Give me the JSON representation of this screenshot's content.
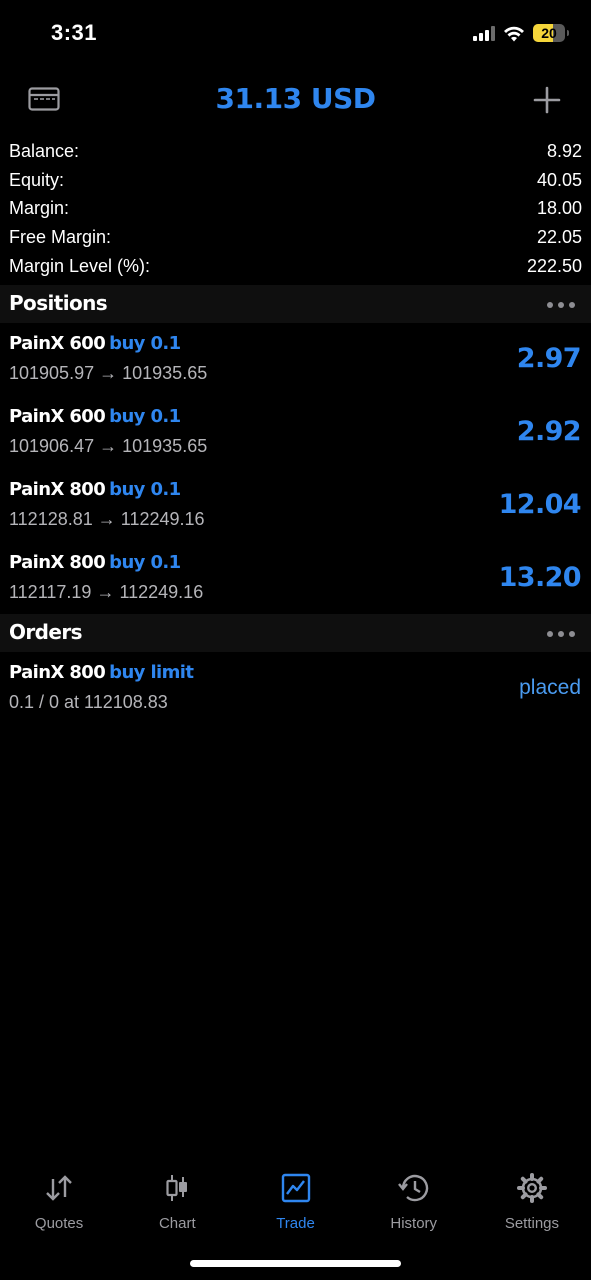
{
  "status_bar": {
    "time": "3:31",
    "battery_level": "20"
  },
  "header": {
    "title": "31.13 USD",
    "left_icon": "wallet-card-icon",
    "right_icon": "plus-icon"
  },
  "summary": [
    {
      "label": "Balance:",
      "value": "8.92"
    },
    {
      "label": "Equity:",
      "value": "40.05"
    },
    {
      "label": "Margin:",
      "value": "18.00"
    },
    {
      "label": "Free Margin:",
      "value": "22.05"
    },
    {
      "label": "Margin Level (%):",
      "value": "222.50"
    }
  ],
  "positions": {
    "title": "Positions",
    "items": [
      {
        "symbol": "PainX 600",
        "type": "buy 0.1",
        "open_price": "101905.97",
        "current_price": "101935.65",
        "profit": "2.97"
      },
      {
        "symbol": "PainX 600",
        "type": "buy 0.1",
        "open_price": "101906.47",
        "current_price": "101935.65",
        "profit": "2.92"
      },
      {
        "symbol": "PainX 800",
        "type": "buy 0.1",
        "open_price": "112128.81",
        "current_price": "112249.16",
        "profit": "12.04"
      },
      {
        "symbol": "PainX 800",
        "type": "buy 0.1",
        "open_price": "112117.19",
        "current_price": "112249.16",
        "profit": "13.20"
      }
    ]
  },
  "orders": {
    "title": "Orders",
    "items": [
      {
        "symbol": "PainX 800",
        "type": "buy limit",
        "detail": "0.1 / 0 at 112108.83",
        "status": "placed"
      }
    ]
  },
  "arrow": "→",
  "tabs": [
    {
      "label": "Quotes",
      "icon": "quotes-arrows-icon",
      "active": false
    },
    {
      "label": "Chart",
      "icon": "chart-candles-icon",
      "active": false
    },
    {
      "label": "Trade",
      "icon": "trade-chart-icon",
      "active": true
    },
    {
      "label": "History",
      "icon": "history-clock-icon",
      "active": false
    },
    {
      "label": "Settings",
      "icon": "settings-gear-icon",
      "active": false
    }
  ],
  "colors": {
    "accent": "#2f86ef",
    "background": "#000000",
    "section_bg": "#0f0f0f",
    "secondary_text": "#b5b5b9"
  }
}
